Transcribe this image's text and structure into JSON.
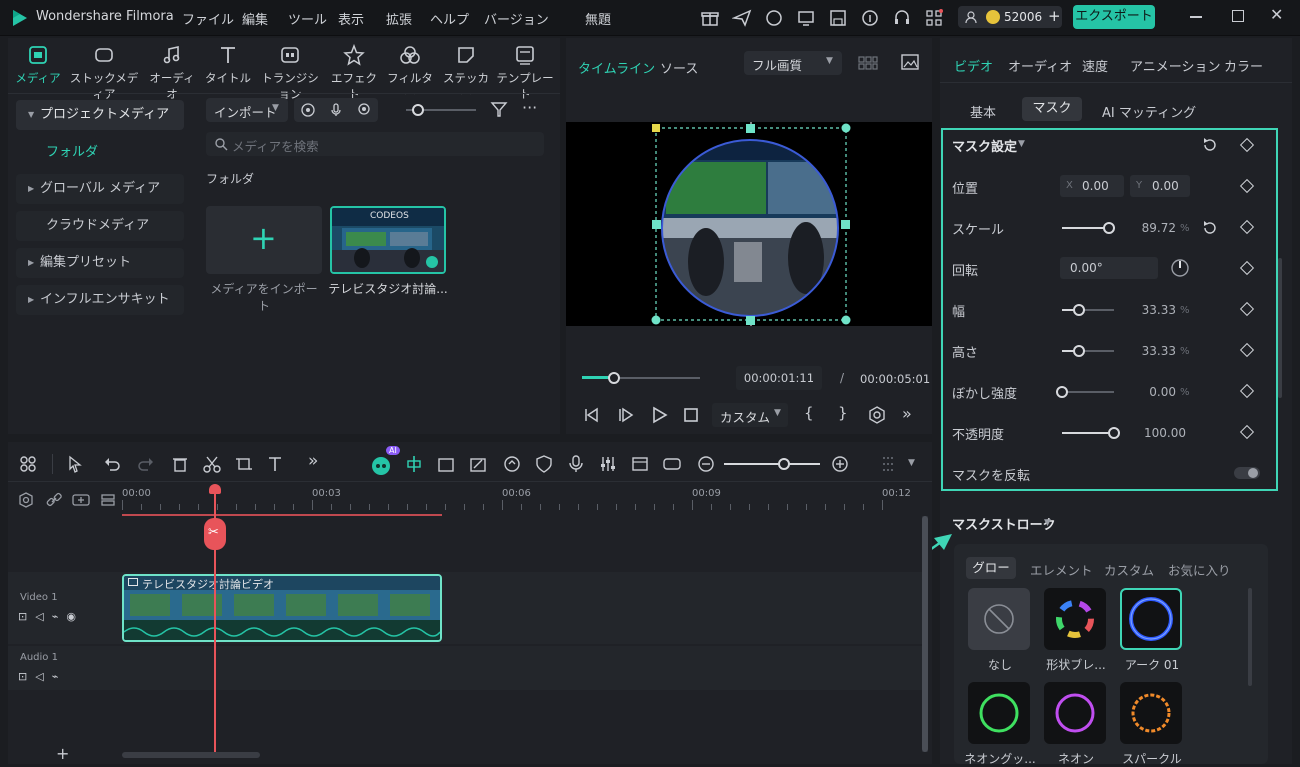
{
  "app": {
    "title": "Wondershare Filmora",
    "project_name": "無題",
    "credits": "52006",
    "export_label": "エクスポート"
  },
  "menu": [
    "ファイル",
    "編集",
    "ツール",
    "表示",
    "拡張",
    "ヘルプ",
    "バージョン"
  ],
  "media_categories": [
    {
      "label": "メディア",
      "icon": "media-icon"
    },
    {
      "label": "ストックメディア",
      "icon": "stock-media-icon"
    },
    {
      "label": "オーディオ",
      "icon": "music-note-icon"
    },
    {
      "label": "タイトル",
      "icon": "title-t-icon"
    },
    {
      "label": "トランジション",
      "icon": "transition-icon"
    },
    {
      "label": "エフェクト",
      "icon": "effect-star-icon"
    },
    {
      "label": "フィルター",
      "icon": "filter-icon"
    },
    {
      "label": "ステッカー",
      "icon": "sticker-icon"
    },
    {
      "label": "テンプレート",
      "icon": "template-icon"
    }
  ],
  "media_sidebar": {
    "project_media": "プロジェクトメディア",
    "folder": "フォルダ",
    "global_media": "グローバル メディア",
    "cloud_media": "クラウドメディア",
    "edit_presets": "編集プリセット",
    "influencer_kit": "インフルエンサキット"
  },
  "media_toolbar": {
    "import_label": "インポート",
    "search_placeholder": "メディアを検索",
    "folder_heading": "フォルダ"
  },
  "media_items": {
    "import_tile_label": "メディアをインポート",
    "clip_label": "テレビスタジオ討論...",
    "clip_thumb_text": "CODEOS"
  },
  "preview": {
    "tab_timeline": "タイムライン",
    "tab_source": "ソース",
    "quality": "フル画質",
    "current_time": "00:00:01:11",
    "separator": "/",
    "total_time": "00:00:05:01",
    "custom_label": "カスタム",
    "progress": 0.27
  },
  "props": {
    "tabs": [
      "ビデオ",
      "オーディオ",
      "速度",
      "アニメーション",
      "カラー"
    ],
    "subtabs": [
      "基本",
      "マスク",
      "AI マッティング"
    ],
    "mask_settings_title": "マスク設定",
    "position_label": "位置",
    "pos_x_prefix": "X",
    "pos_x": "0.00",
    "pos_y_prefix": "Y",
    "pos_y": "0.00",
    "scale_label": "スケール",
    "scale_value": "89.72",
    "scale_level": 0.9,
    "rotation_label": "回転",
    "rotation_value": "0.00°",
    "width_label": "幅",
    "width_value": "33.33",
    "width_level": 0.33,
    "height_label": "高さ",
    "height_value": "33.33",
    "height_level": 0.33,
    "blur_label": "ぼかし強度",
    "blur_value": "0.00",
    "blur_level": 0.0,
    "opacity_label": "不透明度",
    "opacity_value": "100.00",
    "opacity_level": 1.0,
    "invert_label": "マスクを反転",
    "percent": "%",
    "mask_stroke_title": "マスクストローク",
    "stroke_tabs": [
      "グロー",
      "エレメント",
      "カスタム",
      "お気に入り"
    ],
    "stroke_items": [
      "なし",
      "形状ブレ...",
      "アーク 01",
      "ネオングッ...",
      "ネオン",
      "スパークル"
    ]
  },
  "timeline": {
    "ruler": [
      "00:00",
      "00:03",
      "00:06",
      "00:09",
      "00:12"
    ],
    "video_track": "Video 1",
    "audio_track": "Audio 1",
    "clip_title": "テレビスタジオ討論ビデオ",
    "ai_badge": "AI",
    "add_track": "+"
  },
  "colors": {
    "accent": "#25c4a6",
    "playhead": "#e8545a",
    "highlight_box": "#3fd6b6"
  }
}
